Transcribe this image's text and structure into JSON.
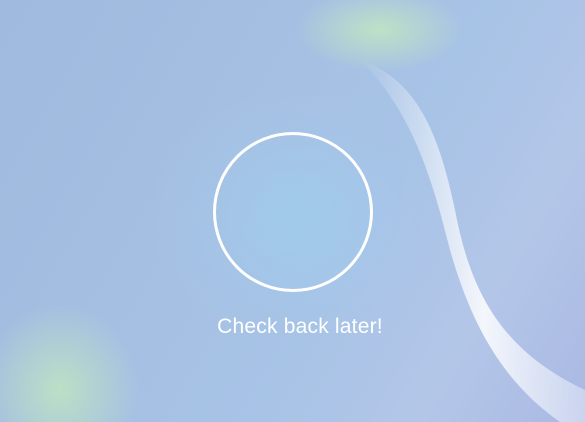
{
  "status": {
    "message": "Check back later!",
    "indicator_icon": "empty-circle-icon"
  },
  "colors": {
    "text": "#ffffff",
    "ring": "#ffffff",
    "background_blue": "#a5bfe2",
    "background_green": "#bde4c4"
  }
}
